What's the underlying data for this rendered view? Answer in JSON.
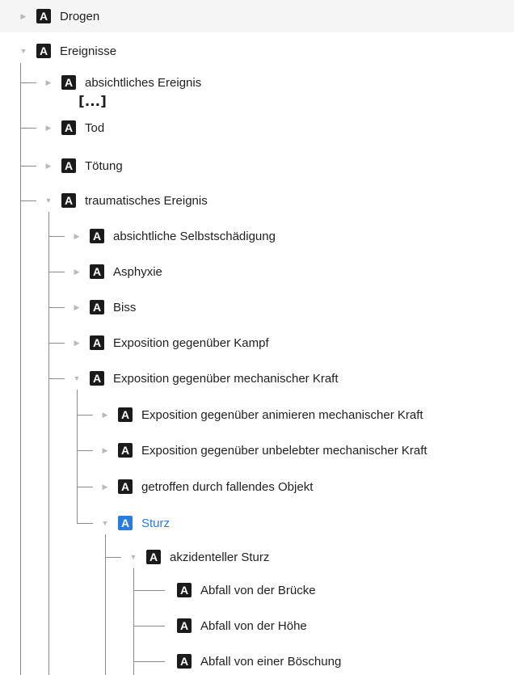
{
  "tree": {
    "nodes": [
      {
        "label": "Drogen",
        "toggle": "▶",
        "badge": "A"
      },
      {
        "label": "Ereignisse",
        "toggle": "▼",
        "badge": "A"
      },
      {
        "label": "absichtliches Ereignis",
        "toggle": "▶",
        "badge": "A"
      },
      {
        "label": "Tod",
        "toggle": "▶",
        "badge": "A"
      },
      {
        "label": "Tötung",
        "toggle": "▶",
        "badge": "A"
      },
      {
        "label": "traumatisches Ereignis",
        "toggle": "▼",
        "badge": "A"
      },
      {
        "label": "absichtliche Selbstschädigung",
        "toggle": "▶",
        "badge": "A"
      },
      {
        "label": "Asphyxie",
        "toggle": "▶",
        "badge": "A"
      },
      {
        "label": "Biss",
        "toggle": "▶",
        "badge": "A"
      },
      {
        "label": "Exposition gegenüber Kampf",
        "toggle": "▶",
        "badge": "A"
      },
      {
        "label": "Exposition gegenüber mechanischer Kraft",
        "toggle": "▼",
        "badge": "A"
      },
      {
        "label": "Exposition gegenüber animieren mechanischer Kraft",
        "toggle": "▶",
        "badge": "A"
      },
      {
        "label": "Exposition gegenüber unbelebter mechanischer Kraft",
        "toggle": "▶",
        "badge": "A"
      },
      {
        "label": "getroffen durch fallendes Objekt",
        "toggle": "▶",
        "badge": "A"
      },
      {
        "label": "Sturz",
        "toggle": "▼",
        "badge": "A",
        "selected": true
      },
      {
        "label": "akzidenteller Sturz",
        "toggle": "▼",
        "badge": "A"
      },
      {
        "label": "Abfall von der Brücke",
        "toggle": "",
        "badge": "A"
      },
      {
        "label": "Abfall von der Höhe",
        "toggle": "",
        "badge": "A"
      },
      {
        "label": "Abfall von einer Böschung",
        "toggle": "",
        "badge": "A"
      }
    ],
    "ellipsis": "[...]",
    "selected_color": "#2b7ce0"
  }
}
